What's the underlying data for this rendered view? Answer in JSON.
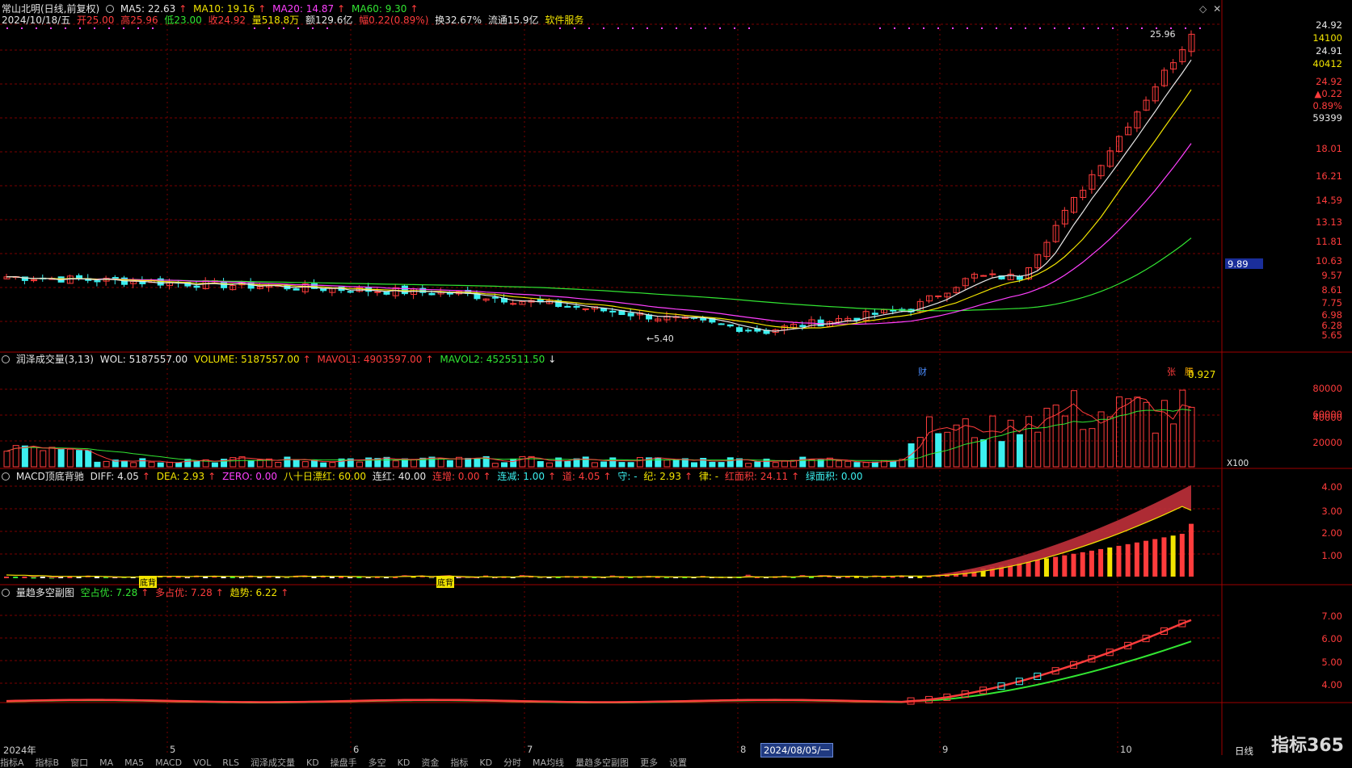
{
  "header": {
    "title": "常山北明(日线,前复权)",
    "ma5": "MA5: 22.63",
    "ma10": "MA10: 19.16",
    "ma20": "MA20: 14.87",
    "ma60": "MA60: 9.30",
    "date": "2024/10/18/五",
    "open": "开25.00",
    "high": "高25.96",
    "low": "低23.00",
    "close": "收24.92",
    "volume": "量518.8万",
    "amount": "额129.6亿",
    "change": "幅0.22(0.89%)",
    "turnover": "换32.67%",
    "float": "流通15.9亿",
    "industry": "软件服务"
  },
  "price_axis": {
    "top_labels": [
      "24.92",
      "14100",
      "24.91",
      "40412",
      "24.92",
      "▲0.22",
      "0.89%",
      "59399"
    ],
    "ticks": [
      "18.01",
      "16.21",
      "14.59",
      "13.13",
      "11.81",
      "10.63",
      "9.57",
      "8.61",
      "7.75",
      "6.98",
      "6.28",
      "5.65"
    ],
    "cursor_value": "9.89",
    "high_marker": "25.96",
    "low_marker": "5.40",
    "badge_cai": "财",
    "badge_zhang": "张",
    "badge_teng": "腾"
  },
  "volume_panel": {
    "title": "润泽成交量(3,13)",
    "wol": "WOL: 5187557.00",
    "volume": "VOLUME: 5187557.00",
    "mavol1": "MAVOL1: 4903597.00",
    "mavol2": "MAVOL2: 4525511.50",
    "ratio": "0.927",
    "ticks": [
      "80000",
      "60000",
      "40000",
      "20000"
    ],
    "unit": "X100"
  },
  "macd_panel": {
    "title": "MACD顶底背驰",
    "diff": "DIFF: 4.05",
    "dea": "DEA: 2.93",
    "zero": "ZERO: 0.00",
    "bashi": "八十日漂红: 60.00",
    "lianhong": "连红: 40.00",
    "lianzeng": "连增: 0.00",
    "lianjian": "连减: 1.00",
    "dao": "道: 4.05",
    "shou": "守: -",
    "ji": "纪: 2.93",
    "lv": "律: -",
    "red_area": "红面积: 24.11",
    "green_area": "绿面积: 0.00",
    "ticks": [
      "4.00",
      "3.00",
      "2.00",
      "1.00"
    ],
    "annot1": "底背",
    "annot2": "底背"
  },
  "trend_panel": {
    "title": "量趋多空副图",
    "kong": "空占优: 7.28",
    "duo": "多占优: 7.28",
    "trend": "趋势: 6.22",
    "ticks": [
      "7.00",
      "6.00",
      "5.00",
      "4.00"
    ]
  },
  "x_axis": {
    "labels": [
      "2024年",
      "5",
      "6",
      "7",
      "8",
      "2024/08/05/一",
      "9",
      "10"
    ],
    "period": "日线"
  },
  "logo": "指标365",
  "tabs": [
    "指标A",
    "指标B",
    "窗口",
    "MA",
    "MA5",
    "MACD",
    "VOL",
    "RLS",
    "润泽成交量",
    "KD",
    "操盘手",
    "多空",
    "KD",
    "资金",
    "指标",
    "KD",
    "分时",
    "MA均线",
    "量趋多空副图",
    "更多",
    "设置"
  ],
  "colors": {
    "up": "#ff3c3c",
    "down": "#3cf0f0",
    "ma5": "#e6e6e6",
    "ma10": "#f2e400",
    "ma20": "#ff40ff",
    "ma60": "#32e632",
    "grid": "#7a0000"
  },
  "chart_data": {
    "type": "candlestick",
    "description_series": [
      {
        "name": "MA5",
        "values_tail": [
          22.63
        ]
      },
      {
        "name": "MA10",
        "values_tail": [
          19.16
        ]
      },
      {
        "name": "MA20",
        "values_tail": [
          14.87
        ]
      },
      {
        "name": "MA60",
        "values_tail": [
          9.3
        ]
      }
    ],
    "y_ticks": [
      5.65,
      6.28,
      6.98,
      7.75,
      8.61,
      9.57,
      10.63,
      11.81,
      13.13,
      14.59,
      16.21,
      18.01
    ],
    "last_close": 24.92,
    "period_high": 25.96,
    "period_low": 5.4,
    "x_months": [
      "2024年",
      "5",
      "6",
      "7",
      "8",
      "9",
      "10"
    ]
  }
}
